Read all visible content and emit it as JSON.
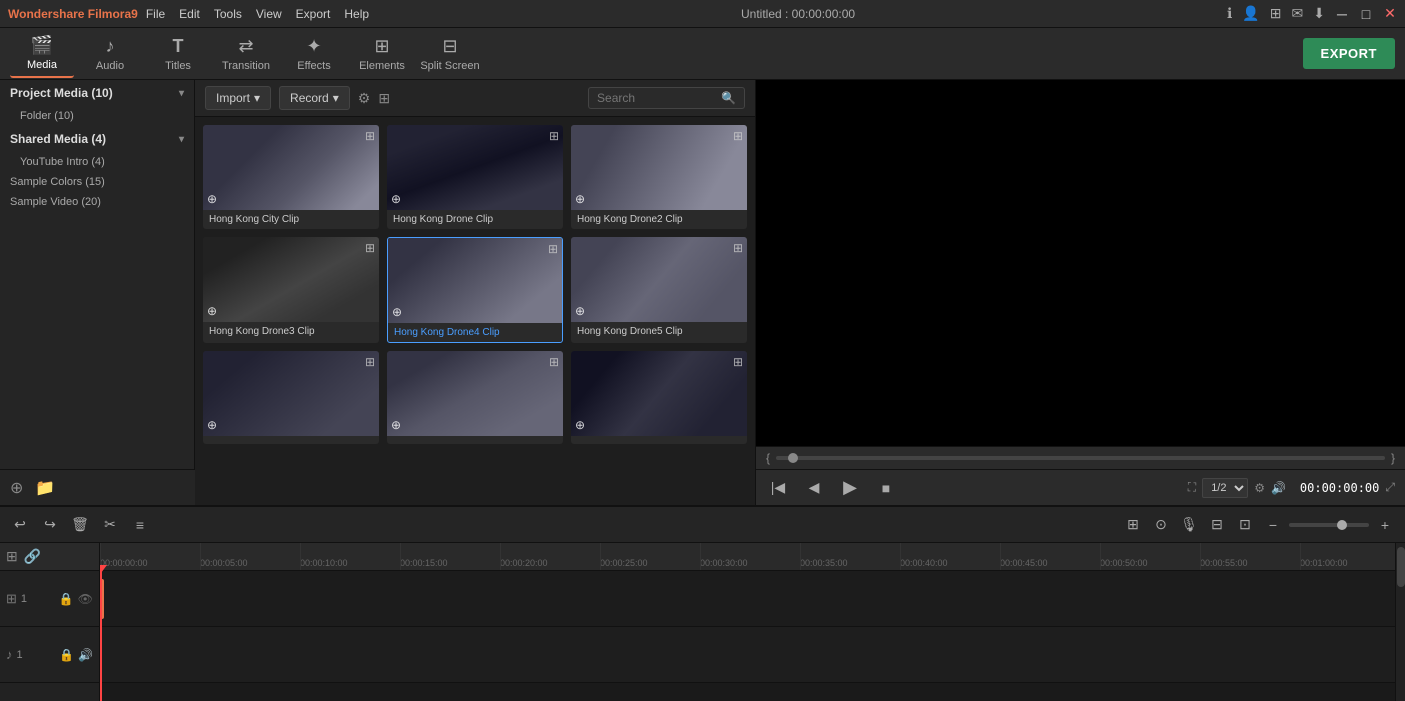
{
  "app": {
    "title": "Wondershare Filmora9",
    "document_title": "Untitled : 00:00:00:00"
  },
  "menu": {
    "items": [
      "File",
      "Edit",
      "Tools",
      "View",
      "Export",
      "Help"
    ]
  },
  "toolbar": {
    "items": [
      {
        "id": "media",
        "label": "Media",
        "icon": "🎬",
        "active": true
      },
      {
        "id": "audio",
        "label": "Audio",
        "icon": "♪"
      },
      {
        "id": "titles",
        "label": "Titles",
        "icon": "T"
      },
      {
        "id": "transition",
        "label": "Transition",
        "icon": "✦"
      },
      {
        "id": "effects",
        "label": "Effects",
        "icon": "✧"
      },
      {
        "id": "elements",
        "label": "Elements",
        "icon": "⊞"
      },
      {
        "id": "splitscreen",
        "label": "Split Screen",
        "icon": "⊟"
      }
    ],
    "export_label": "EXPORT"
  },
  "sidebar": {
    "project_media": {
      "label": "Project Media",
      "count": 10
    },
    "folder": {
      "label": "Folder",
      "count": 10
    },
    "shared_media": {
      "label": "Shared Media",
      "count": 4
    },
    "youtube_intro": {
      "label": "YouTube Intro",
      "count": 4
    },
    "sample_colors": {
      "label": "Sample Colors",
      "count": 15
    },
    "sample_video": {
      "label": "Sample Video",
      "count": 20
    }
  },
  "content_toolbar": {
    "import_label": "Import",
    "record_label": "Record",
    "search_placeholder": "Search"
  },
  "media_grid": {
    "items": [
      {
        "id": 1,
        "label": "Hong Kong City Clip",
        "theme": "hk-city",
        "active": false
      },
      {
        "id": 2,
        "label": "Hong Kong Drone Clip",
        "theme": "hk-drone1",
        "active": false
      },
      {
        "id": 3,
        "label": "Hong Kong Drone2 Clip",
        "theme": "hk-drone2",
        "active": false
      },
      {
        "id": 4,
        "label": "Hong Kong Drone3 Clip",
        "theme": "hk-drone3",
        "active": false
      },
      {
        "id": 5,
        "label": "Hong Kong Drone4 Clip",
        "theme": "hk-drone4",
        "active": true
      },
      {
        "id": 6,
        "label": "Hong Kong Drone5 Clip",
        "theme": "hk-drone5",
        "active": false
      },
      {
        "id": 7,
        "label": "",
        "theme": "hk-street1",
        "active": false
      },
      {
        "id": 8,
        "label": "",
        "theme": "hk-street2",
        "active": false
      },
      {
        "id": 9,
        "label": "",
        "theme": "hk-night",
        "active": false
      }
    ]
  },
  "preview": {
    "timecode": "00:00:00:00",
    "speed": "1/2"
  },
  "timeline": {
    "timecode": "00:00:00:00",
    "ruler_marks": [
      "00:00:00:00",
      "00:00:05:00",
      "00:00:10:00",
      "00:00:15:00",
      "00:00:20:00",
      "00:00:25:00",
      "00:00:30:00",
      "00:00:35:00",
      "00:00:40:00",
      "00:00:45:00",
      "00:00:50:00",
      "00:00:55:00",
      "00:01:00:00"
    ],
    "tracks": [
      {
        "id": "v1",
        "icon": "⊞",
        "number": "1",
        "type": "video"
      },
      {
        "id": "a1",
        "icon": "♪",
        "number": "1",
        "type": "audio"
      }
    ]
  }
}
